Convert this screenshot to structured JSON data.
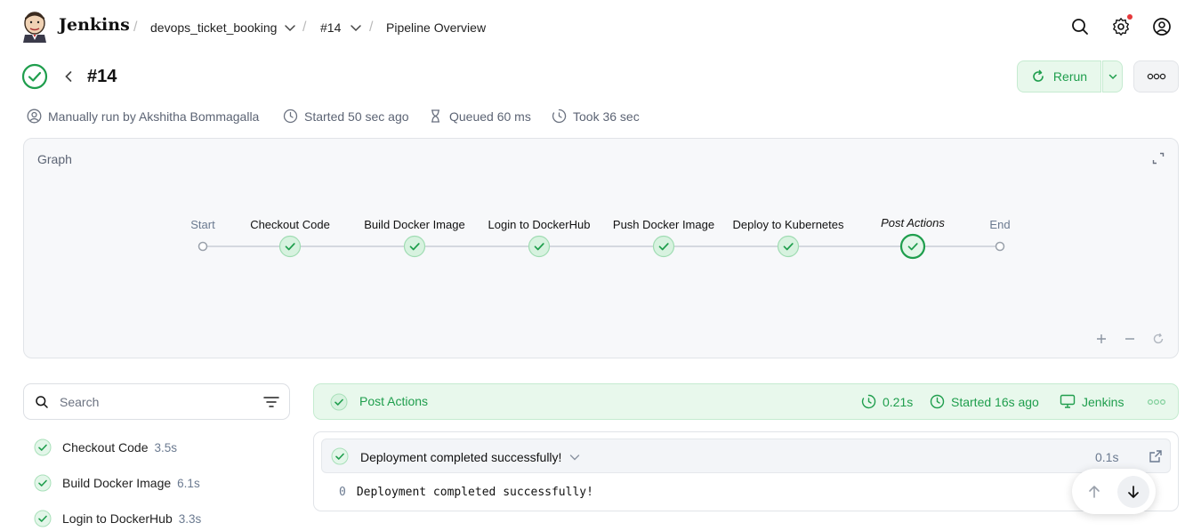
{
  "header": {
    "brand": "Jenkins",
    "breadcrumbs": [
      "devops_ticket_booking",
      "#14",
      "Pipeline Overview"
    ],
    "separator": "/"
  },
  "run": {
    "title": "#14",
    "status": "success",
    "rerun_label": "Rerun",
    "meta": {
      "trigger": "Manually run by Akshitha Bommagalla",
      "started": "Started 50 sec ago",
      "queued": "Queued 60 ms",
      "took": "Took 36 sec"
    }
  },
  "graph": {
    "title": "Graph",
    "nodes": [
      {
        "label": "Start",
        "kind": "terminal"
      },
      {
        "label": "Checkout Code",
        "kind": "stage"
      },
      {
        "label": "Build Docker Image",
        "kind": "stage"
      },
      {
        "label": "Login to DockerHub",
        "kind": "stage"
      },
      {
        "label": "Push Docker Image",
        "kind": "stage"
      },
      {
        "label": "Deploy to Kubernetes",
        "kind": "stage"
      },
      {
        "label": "Post Actions",
        "kind": "selected"
      },
      {
        "label": "End",
        "kind": "terminal"
      }
    ]
  },
  "search": {
    "placeholder": "Search"
  },
  "stages": [
    {
      "name": "Checkout Code",
      "duration": "3.5s"
    },
    {
      "name": "Build Docker Image",
      "duration": "6.1s"
    },
    {
      "name": "Login to DockerHub",
      "duration": "3.3s"
    }
  ],
  "selected_stage": {
    "name": "Post Actions",
    "duration": "0.21s",
    "started": "Started 16s ago",
    "agent": "Jenkins"
  },
  "step": {
    "title": "Deployment completed successfully!",
    "duration": "0.1s",
    "log_lines": [
      {
        "number": "0",
        "text": "Deployment completed successfully!"
      }
    ]
  },
  "colors": {
    "success": "#1f9e4d",
    "success_bg": "#e8f8ec",
    "notification": "#e5383b"
  }
}
